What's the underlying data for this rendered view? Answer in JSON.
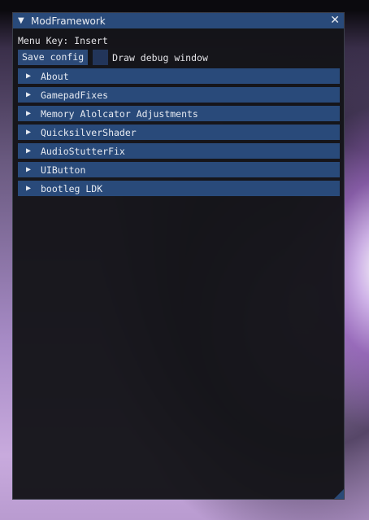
{
  "window": {
    "title": "ModFramework",
    "collapse_glyph": "▼",
    "close_glyph": "✕"
  },
  "menu_key_text": "Menu Key: Insert",
  "save_button_label": "Save config",
  "debug_checkbox": {
    "label": "Draw debug window",
    "checked": false
  },
  "sections": [
    {
      "arrow": "▶",
      "label": "About"
    },
    {
      "arrow": "▶",
      "label": "GamepadFixes"
    },
    {
      "arrow": "▶",
      "label": "Memory Alolcator Adjustments"
    },
    {
      "arrow": "▶",
      "label": "QuicksilverShader"
    },
    {
      "arrow": "▶",
      "label": "AudioStutterFix"
    },
    {
      "arrow": "▶",
      "label": "UIButton"
    },
    {
      "arrow": "▶",
      "label": "bootleg LDK"
    }
  ]
}
